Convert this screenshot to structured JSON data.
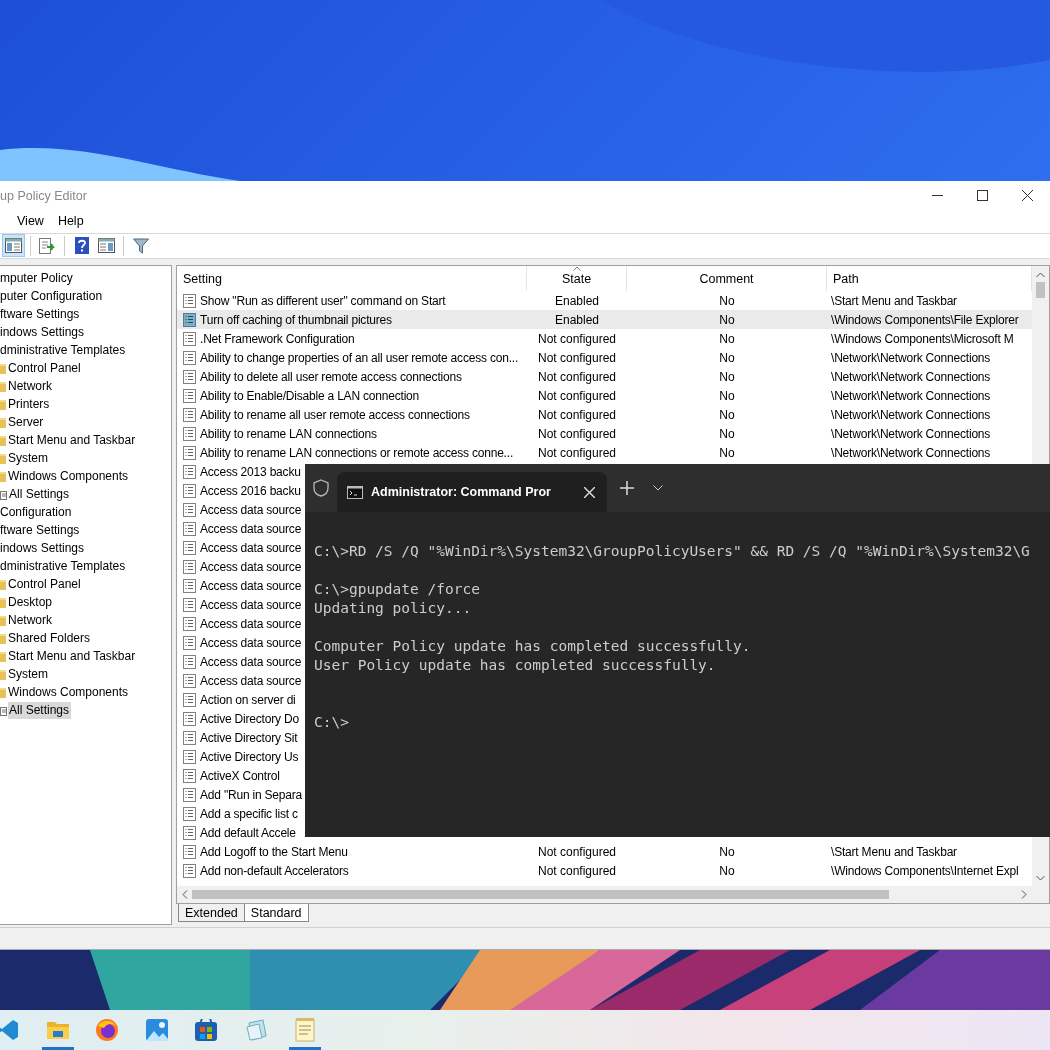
{
  "editor": {
    "title": "up Policy Editor",
    "menu": [
      "View",
      "Help"
    ],
    "toolbar": [
      {
        "kind": "panel",
        "selected": true
      },
      {
        "kind": "export",
        "selected": false
      },
      {
        "kind": "help",
        "selected": false
      },
      {
        "kind": "view",
        "selected": false
      },
      {
        "kind": "filter",
        "selected": false
      }
    ],
    "tree": [
      {
        "label": "mputer Policy",
        "selected": false,
        "children": [
          {
            "label": "puter Configuration",
            "selected": false,
            "children": [
              {
                "label": "ftware Settings",
                "selected": false
              },
              {
                "label": "indows Settings",
                "selected": false
              },
              {
                "label": "dministrative Templates",
                "selected": false,
                "children": [
                  {
                    "label": "Control Panel",
                    "kind": "folder",
                    "selected": false
                  },
                  {
                    "label": "Network",
                    "kind": "folder",
                    "selected": false
                  },
                  {
                    "label": "Printers",
                    "kind": "folder",
                    "selected": false
                  },
                  {
                    "label": "Server",
                    "kind": "folder",
                    "selected": false
                  },
                  {
                    "label": "Start Menu and Taskbar",
                    "kind": "folder",
                    "selected": false
                  },
                  {
                    "label": "System",
                    "kind": "folder",
                    "selected": false
                  },
                  {
                    "label": "Windows Components",
                    "kind": "folder",
                    "selected": false
                  },
                  {
                    "label": "All Settings",
                    "kind": "settings",
                    "selected": false
                  }
                ]
              }
            ]
          },
          {
            "label": "Configuration",
            "selected": false,
            "children": [
              {
                "label": "ftware Settings",
                "selected": false
              },
              {
                "label": "indows Settings",
                "selected": false
              },
              {
                "label": "dministrative Templates",
                "selected": false,
                "children": [
                  {
                    "label": "Control Panel",
                    "kind": "folder",
                    "selected": false
                  },
                  {
                    "label": "Desktop",
                    "kind": "folder",
                    "selected": false
                  },
                  {
                    "label": "Network",
                    "kind": "folder",
                    "selected": false
                  },
                  {
                    "label": "Shared Folders",
                    "kind": "folder",
                    "selected": false
                  },
                  {
                    "label": "Start Menu and Taskbar",
                    "kind": "folder",
                    "selected": false
                  },
                  {
                    "label": "System",
                    "kind": "folder",
                    "selected": false
                  },
                  {
                    "label": "Windows Components",
                    "kind": "folder",
                    "selected": false
                  },
                  {
                    "label": "All Settings",
                    "kind": "settings",
                    "selected": true
                  }
                ]
              }
            ]
          }
        ]
      }
    ],
    "table": {
      "columns": [
        {
          "label": "Setting",
          "sorted": false
        },
        {
          "label": "State",
          "sorted": true
        },
        {
          "label": "Comment",
          "sorted": false
        },
        {
          "label": "Path",
          "sorted": false
        }
      ],
      "rows": [
        {
          "setting": "Show \"Run as different user\" command on Start",
          "state": "Enabled",
          "comment": "No",
          "path": "\\Start Menu and Taskbar",
          "selected": false
        },
        {
          "setting": "Turn off caching of thumbnail pictures",
          "state": "Enabled",
          "comment": "No",
          "path": "\\Windows Components\\File Explorer",
          "selected": true
        },
        {
          "setting": ".Net Framework Configuration",
          "state": "Not configured",
          "comment": "No",
          "path": "\\Windows Components\\Microsoft M",
          "selected": false
        },
        {
          "setting": "Ability to change properties of an all user remote access con...",
          "state": "Not configured",
          "comment": "No",
          "path": "\\Network\\Network Connections",
          "selected": false
        },
        {
          "setting": "Ability to delete all user remote access connections",
          "state": "Not configured",
          "comment": "No",
          "path": "\\Network\\Network Connections",
          "selected": false
        },
        {
          "setting": "Ability to Enable/Disable a LAN connection",
          "state": "Not configured",
          "comment": "No",
          "path": "\\Network\\Network Connections",
          "selected": false
        },
        {
          "setting": "Ability to rename all user remote access connections",
          "state": "Not configured",
          "comment": "No",
          "path": "\\Network\\Network Connections",
          "selected": false
        },
        {
          "setting": "Ability to rename LAN connections",
          "state": "Not configured",
          "comment": "No",
          "path": "\\Network\\Network Connections",
          "selected": false
        },
        {
          "setting": "Ability to rename LAN connections or remote access conne...",
          "state": "Not configured",
          "comment": "No",
          "path": "\\Network\\Network Connections",
          "selected": false
        },
        {
          "setting": "Access 2013 backu",
          "selected": false
        },
        {
          "setting": "Access 2016 backu",
          "selected": false
        },
        {
          "setting": "Access data source",
          "selected": false
        },
        {
          "setting": "Access data source",
          "selected": false
        },
        {
          "setting": "Access data source",
          "selected": false
        },
        {
          "setting": "Access data source",
          "selected": false
        },
        {
          "setting": "Access data source",
          "selected": false
        },
        {
          "setting": "Access data source",
          "selected": false
        },
        {
          "setting": "Access data source",
          "selected": false
        },
        {
          "setting": "Access data source",
          "selected": false
        },
        {
          "setting": "Access data source",
          "selected": false
        },
        {
          "setting": "Access data source",
          "selected": false
        },
        {
          "setting": "Action on server di",
          "selected": false
        },
        {
          "setting": "Active Directory Do",
          "selected": false
        },
        {
          "setting": "Active Directory Sit",
          "selected": false
        },
        {
          "setting": "Active Directory Us",
          "selected": false
        },
        {
          "setting": "ActiveX Control",
          "selected": false
        },
        {
          "setting": "Add \"Run in Separa",
          "selected": false
        },
        {
          "setting": "Add a specific list c",
          "selected": false
        },
        {
          "setting": "Add default Accele",
          "selected": false
        },
        {
          "setting": "Add Logoff to the Start Menu",
          "state": "Not configured",
          "comment": "No",
          "path": "\\Start Menu and Taskbar",
          "selected": false
        },
        {
          "setting": "Add non-default Accelerators",
          "state": "Not configured",
          "comment": "No",
          "path": "\\Windows Components\\Internet Expl",
          "selected": false
        }
      ]
    },
    "view_tabs": [
      {
        "label": "Extended",
        "selected": false
      },
      {
        "label": "Standard",
        "selected": true
      }
    ]
  },
  "terminal": {
    "tab_title": "Administrator: Command Pror",
    "blocks": [
      [
        "C:\\>RD /S /Q \"%WinDir%\\System32\\GroupPolicyUsers\" && RD /S /Q \"%WinDir%\\System32\\G"
      ],
      [
        "C:\\>gpupdate /force",
        "Updating policy..."
      ],
      [
        "Computer Policy update has completed successfully.",
        "User Policy update has completed successfully."
      ],
      [
        "C:\\>"
      ]
    ]
  },
  "taskbar": [
    {
      "kind": "code",
      "running": false
    },
    {
      "kind": "folder",
      "running": true
    },
    {
      "kind": "browser",
      "running": false
    },
    {
      "kind": "photos",
      "running": false
    },
    {
      "kind": "store",
      "running": false
    },
    {
      "kind": "notes",
      "running": false
    },
    {
      "kind": "notepad",
      "running": true
    }
  ]
}
